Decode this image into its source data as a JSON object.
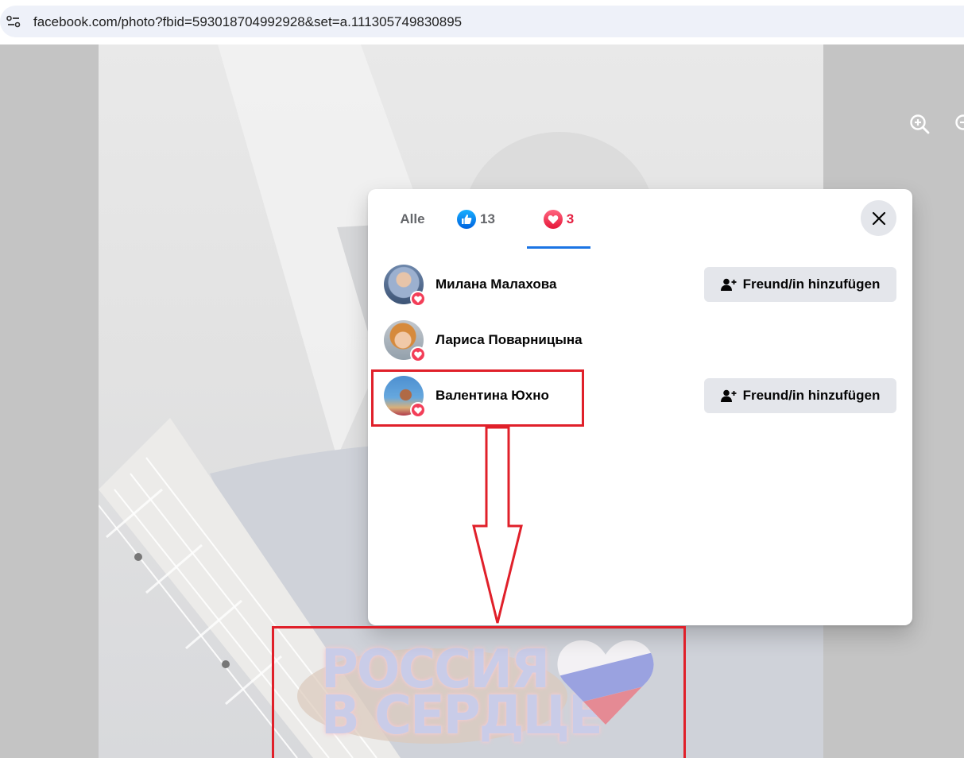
{
  "browser": {
    "url": "facebook.com/photo?fbid=593018704992928&set=a.111305749830895"
  },
  "photo": {
    "sticker_line1": "РОССИЯ",
    "sticker_line2": "В СЕРДЦЕ"
  },
  "modal": {
    "tabs": [
      {
        "label": "Alle"
      },
      {
        "label": "13",
        "icon": "like-icon"
      },
      {
        "label": "3",
        "icon": "love-icon",
        "selected": true
      }
    ],
    "people": [
      {
        "name": "Милана Малахова",
        "reaction": "love-icon",
        "button": "Freund/in hinzufügen"
      },
      {
        "name": "Лариса Поварницына",
        "reaction": "love-icon"
      },
      {
        "name": "Валентина Юхно",
        "reaction": "love-icon",
        "button": "Freund/in hinzufügen"
      }
    ]
  },
  "colors": {
    "annotation": "#e0202a",
    "accent": "#1b74e4",
    "love": "#f33e58"
  }
}
